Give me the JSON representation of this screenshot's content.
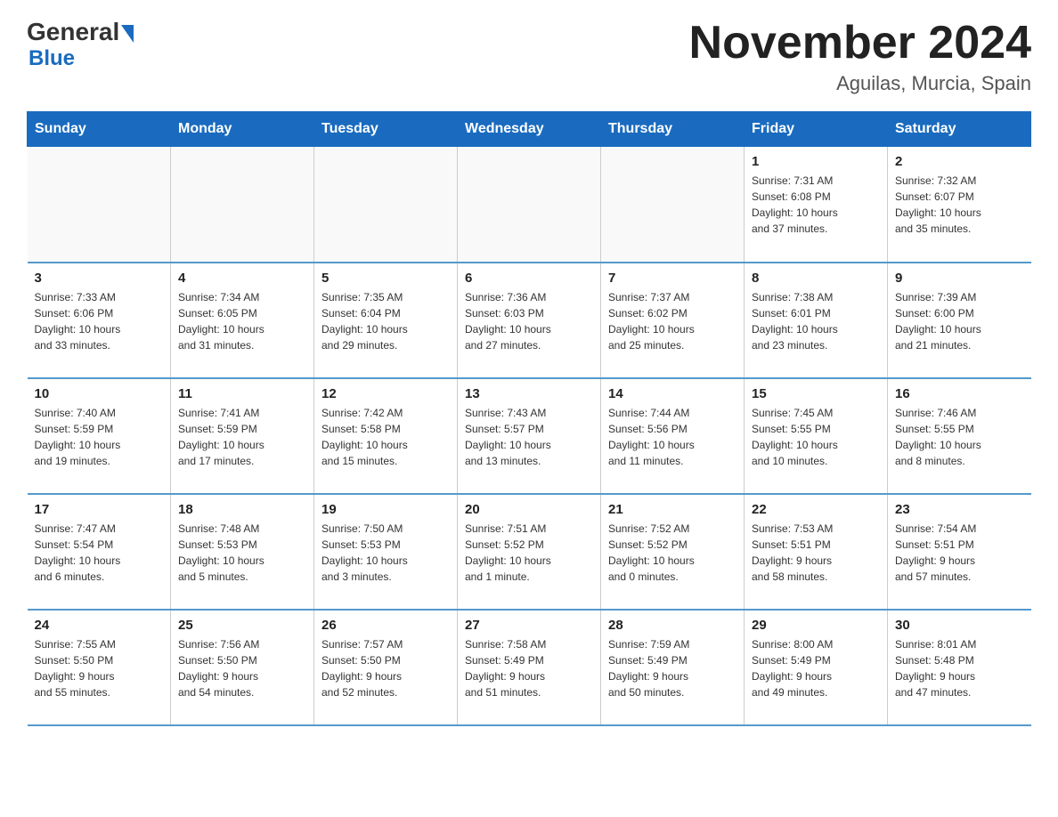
{
  "logo": {
    "general": "General",
    "blue": "Blue"
  },
  "header": {
    "title": "November 2024",
    "subtitle": "Aguilas, Murcia, Spain"
  },
  "weekdays": [
    "Sunday",
    "Monday",
    "Tuesday",
    "Wednesday",
    "Thursday",
    "Friday",
    "Saturday"
  ],
  "weeks": [
    [
      {
        "day": "",
        "info": ""
      },
      {
        "day": "",
        "info": ""
      },
      {
        "day": "",
        "info": ""
      },
      {
        "day": "",
        "info": ""
      },
      {
        "day": "",
        "info": ""
      },
      {
        "day": "1",
        "info": "Sunrise: 7:31 AM\nSunset: 6:08 PM\nDaylight: 10 hours\nand 37 minutes."
      },
      {
        "day": "2",
        "info": "Sunrise: 7:32 AM\nSunset: 6:07 PM\nDaylight: 10 hours\nand 35 minutes."
      }
    ],
    [
      {
        "day": "3",
        "info": "Sunrise: 7:33 AM\nSunset: 6:06 PM\nDaylight: 10 hours\nand 33 minutes."
      },
      {
        "day": "4",
        "info": "Sunrise: 7:34 AM\nSunset: 6:05 PM\nDaylight: 10 hours\nand 31 minutes."
      },
      {
        "day": "5",
        "info": "Sunrise: 7:35 AM\nSunset: 6:04 PM\nDaylight: 10 hours\nand 29 minutes."
      },
      {
        "day": "6",
        "info": "Sunrise: 7:36 AM\nSunset: 6:03 PM\nDaylight: 10 hours\nand 27 minutes."
      },
      {
        "day": "7",
        "info": "Sunrise: 7:37 AM\nSunset: 6:02 PM\nDaylight: 10 hours\nand 25 minutes."
      },
      {
        "day": "8",
        "info": "Sunrise: 7:38 AM\nSunset: 6:01 PM\nDaylight: 10 hours\nand 23 minutes."
      },
      {
        "day": "9",
        "info": "Sunrise: 7:39 AM\nSunset: 6:00 PM\nDaylight: 10 hours\nand 21 minutes."
      }
    ],
    [
      {
        "day": "10",
        "info": "Sunrise: 7:40 AM\nSunset: 5:59 PM\nDaylight: 10 hours\nand 19 minutes."
      },
      {
        "day": "11",
        "info": "Sunrise: 7:41 AM\nSunset: 5:59 PM\nDaylight: 10 hours\nand 17 minutes."
      },
      {
        "day": "12",
        "info": "Sunrise: 7:42 AM\nSunset: 5:58 PM\nDaylight: 10 hours\nand 15 minutes."
      },
      {
        "day": "13",
        "info": "Sunrise: 7:43 AM\nSunset: 5:57 PM\nDaylight: 10 hours\nand 13 minutes."
      },
      {
        "day": "14",
        "info": "Sunrise: 7:44 AM\nSunset: 5:56 PM\nDaylight: 10 hours\nand 11 minutes."
      },
      {
        "day": "15",
        "info": "Sunrise: 7:45 AM\nSunset: 5:55 PM\nDaylight: 10 hours\nand 10 minutes."
      },
      {
        "day": "16",
        "info": "Sunrise: 7:46 AM\nSunset: 5:55 PM\nDaylight: 10 hours\nand 8 minutes."
      }
    ],
    [
      {
        "day": "17",
        "info": "Sunrise: 7:47 AM\nSunset: 5:54 PM\nDaylight: 10 hours\nand 6 minutes."
      },
      {
        "day": "18",
        "info": "Sunrise: 7:48 AM\nSunset: 5:53 PM\nDaylight: 10 hours\nand 5 minutes."
      },
      {
        "day": "19",
        "info": "Sunrise: 7:50 AM\nSunset: 5:53 PM\nDaylight: 10 hours\nand 3 minutes."
      },
      {
        "day": "20",
        "info": "Sunrise: 7:51 AM\nSunset: 5:52 PM\nDaylight: 10 hours\nand 1 minute."
      },
      {
        "day": "21",
        "info": "Sunrise: 7:52 AM\nSunset: 5:52 PM\nDaylight: 10 hours\nand 0 minutes."
      },
      {
        "day": "22",
        "info": "Sunrise: 7:53 AM\nSunset: 5:51 PM\nDaylight: 9 hours\nand 58 minutes."
      },
      {
        "day": "23",
        "info": "Sunrise: 7:54 AM\nSunset: 5:51 PM\nDaylight: 9 hours\nand 57 minutes."
      }
    ],
    [
      {
        "day": "24",
        "info": "Sunrise: 7:55 AM\nSunset: 5:50 PM\nDaylight: 9 hours\nand 55 minutes."
      },
      {
        "day": "25",
        "info": "Sunrise: 7:56 AM\nSunset: 5:50 PM\nDaylight: 9 hours\nand 54 minutes."
      },
      {
        "day": "26",
        "info": "Sunrise: 7:57 AM\nSunset: 5:50 PM\nDaylight: 9 hours\nand 52 minutes."
      },
      {
        "day": "27",
        "info": "Sunrise: 7:58 AM\nSunset: 5:49 PM\nDaylight: 9 hours\nand 51 minutes."
      },
      {
        "day": "28",
        "info": "Sunrise: 7:59 AM\nSunset: 5:49 PM\nDaylight: 9 hours\nand 50 minutes."
      },
      {
        "day": "29",
        "info": "Sunrise: 8:00 AM\nSunset: 5:49 PM\nDaylight: 9 hours\nand 49 minutes."
      },
      {
        "day": "30",
        "info": "Sunrise: 8:01 AM\nSunset: 5:48 PM\nDaylight: 9 hours\nand 47 minutes."
      }
    ]
  ]
}
